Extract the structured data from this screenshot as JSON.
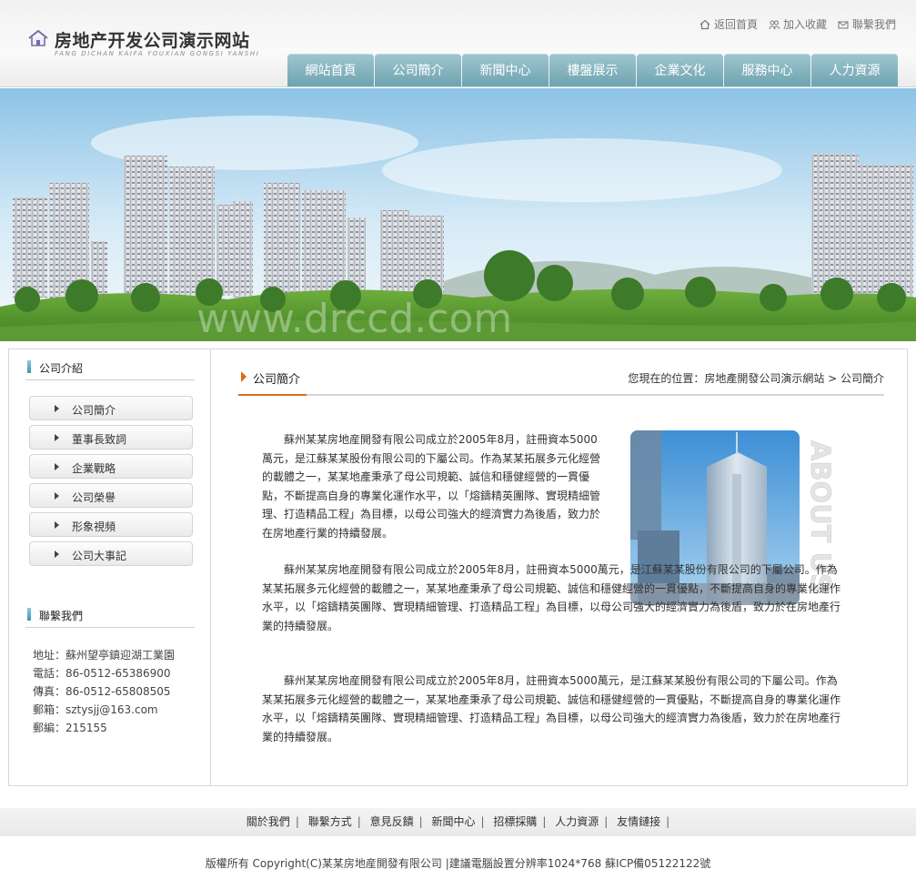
{
  "header": {
    "site_title": "房地产开发公司演示网站",
    "site_subtitle": "FANG DICHAN KAIFA YOUXIAN GONGSI YANSHI",
    "top_links": [
      "返回首頁",
      "加入收藏",
      "聯繫我們"
    ]
  },
  "nav": [
    "網站首頁",
    "公司簡介",
    "新聞中心",
    "樓盤展示",
    "企業文化",
    "服務中心",
    "人力資源"
  ],
  "banner": {
    "watermark": "www.drccd.com"
  },
  "sidebar": {
    "about_heading": "公司介紹",
    "menu": [
      "公司簡介",
      "董事長致詞",
      "企業戰略",
      "公司榮譽",
      "形象視頻",
      "公司大事記"
    ],
    "contact_heading": "聯繫我們",
    "contact": [
      "地址：蘇州望亭鎮迎湖工業園",
      "電話：86-0512-65386900",
      "傳真：86-0512-65808505",
      "郵箱：sztysjj@163.com",
      "郵編：215155"
    ]
  },
  "content": {
    "title": "公司簡介",
    "breadcrumb": "您現在的位置：房地產開發公司演示網站 > 公司簡介",
    "about_text": "ABOUT US",
    "paragraphs": [
      "蘇州某某房地産開發有限公司成立於2005年8月，註冊資本5000萬元，是江蘇某某股份有限公司的下屬公司。作為某某拓展多元化經營的載體之一，某某地產秉承了母公司規範、誠信和穩健經營的一貫優點，不斷提高自身的專業化運作水平，以「熔鑄精英團隊、實現精細管理、打造精品工程」為目標，以母公司強大的經濟實力為後盾，致力於在房地產行業的持續發展。",
      "蘇州某某房地産開發有限公司成立於2005年8月，註冊資本5000萬元，是江蘇某某股份有限公司的下屬公司。作為某某拓展多元化經營的載體之一，某某地產秉承了母公司規範、誠信和穩健經營的一貫優點，不斷提高自身的專業化運作水平，以「熔鑄精英團隊、實現精細管理、打造精品工程」為目標，以母公司強大的經濟實力為後盾，致力於在房地產行業的持續發展。",
      "蘇州某某房地産開發有限公司成立於2005年8月，註冊資本5000萬元，是江蘇某某股份有限公司的下屬公司。作為某某拓展多元化經營的載體之一，某某地產秉承了母公司規範、誠信和穩健經營的一貫優點，不斷提高自身的專業化運作水平，以「熔鑄精英團隊、實現精細管理、打造精品工程」為目標，以母公司強大的經濟實力為後盾，致力於在房地產行業的持續發展。"
    ]
  },
  "footer": {
    "links": [
      "關於我們",
      "聯繫方式",
      "意見反饋",
      "新聞中心",
      "招標採購",
      "人力資源",
      "友情鏈接"
    ],
    "copyright": "版權所有 Copyright(C)某某房地産開發有限公司  |建議電腦設置分辨率1024*768 蘇ICP備05122122號"
  },
  "colors": {
    "nav_tab": "#7fb2bd",
    "accent": "#e06a1a",
    "side_bar": "#3f93b3"
  }
}
